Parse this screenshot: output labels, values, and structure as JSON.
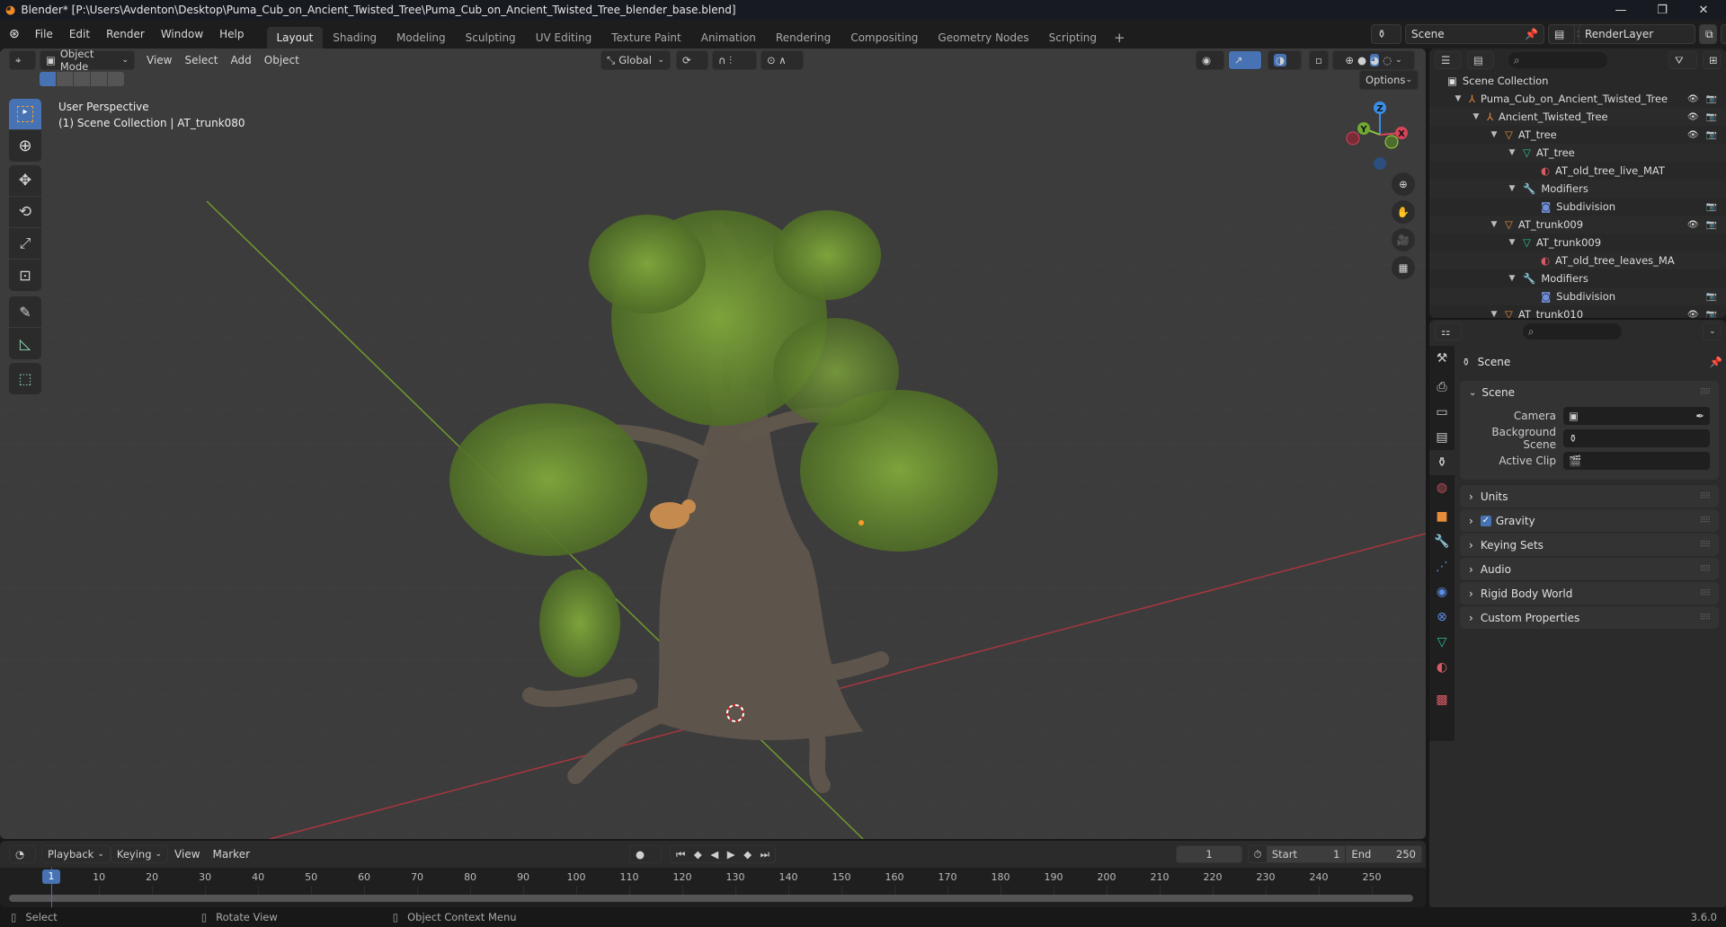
{
  "window": {
    "title": "Blender* [P:\\Users\\Avdenton\\Desktop\\Puma_Cub_on_Ancient_Twisted_Tree\\Puma_Cub_on_Ancient_Twisted_Tree_blender_base.blend]",
    "minimize": "—",
    "maximize": "❐",
    "close": "✕"
  },
  "menu": [
    "File",
    "Edit",
    "Render",
    "Window",
    "Help"
  ],
  "workspaces": [
    {
      "label": "Layout",
      "active": true
    },
    {
      "label": "Shading"
    },
    {
      "label": "Modeling"
    },
    {
      "label": "Sculpting"
    },
    {
      "label": "UV Editing"
    },
    {
      "label": "Texture Paint"
    },
    {
      "label": "Animation"
    },
    {
      "label": "Rendering"
    },
    {
      "label": "Compositing"
    },
    {
      "label": "Geometry Nodes"
    },
    {
      "label": "Scripting"
    },
    {
      "label": "+"
    }
  ],
  "scene_selector": {
    "value": "Scene"
  },
  "view_layer_selector": {
    "value": "RenderLayer"
  },
  "viewport_header": {
    "mode": "Object Mode",
    "menus": [
      "View",
      "Select",
      "Add",
      "Object"
    ],
    "transform_orientation": "Global",
    "options": "Options"
  },
  "viewport": {
    "perspective": "User Perspective",
    "context": "(1) Scene Collection | AT_trunk080",
    "gizmo": {
      "x": "X",
      "y": "Y",
      "z": "Z"
    }
  },
  "tools": [
    "select-box",
    "cursor",
    "move",
    "rotate",
    "scale",
    "transform",
    "annotate",
    "measure",
    "add-cube"
  ],
  "outliner": {
    "root": "Scene Collection",
    "items": [
      {
        "label": "Puma_Cub_on_Ancient_Twisted_Tree",
        "type": "empty",
        "depth": 0,
        "expanded": true,
        "eye": true,
        "render": true
      },
      {
        "label": "Ancient_Twisted_Tree",
        "type": "empty",
        "depth": 1,
        "expanded": true,
        "eye": true,
        "render": true
      },
      {
        "label": "AT_tree",
        "type": "object",
        "depth": 2,
        "expanded": true,
        "eye": true,
        "render": true
      },
      {
        "label": "AT_tree",
        "type": "mesh",
        "depth": 3,
        "expanded": true
      },
      {
        "label": "AT_old_tree_live_MAT",
        "type": "material",
        "depth": 4
      },
      {
        "label": "Modifiers",
        "type": "modifier",
        "depth": 3,
        "expanded": true
      },
      {
        "label": "Subdivision",
        "type": "subdiv",
        "depth": 4,
        "render": true
      },
      {
        "label": "AT_trunk009",
        "type": "object",
        "depth": 2,
        "expanded": true,
        "eye": true,
        "render": true
      },
      {
        "label": "AT_trunk009",
        "type": "mesh",
        "depth": 3,
        "expanded": true
      },
      {
        "label": "AT_old_tree_leaves_MA",
        "type": "material",
        "depth": 4
      },
      {
        "label": "Modifiers",
        "type": "modifier",
        "depth": 3,
        "expanded": true
      },
      {
        "label": "Subdivision",
        "type": "subdiv",
        "depth": 4,
        "render": true
      },
      {
        "label": "AT_trunk010",
        "type": "object",
        "depth": 2,
        "expanded": true,
        "eye": true,
        "render": true
      }
    ]
  },
  "properties": {
    "context_title": "Scene",
    "panels": {
      "scene": {
        "title": "Scene",
        "camera_label": "Camera",
        "background_scene_label": "Background Scene",
        "active_clip_label": "Active Clip"
      },
      "collapsed": [
        "Units",
        "Gravity",
        "Keying Sets",
        "Audio",
        "Rigid Body World",
        "Custom Properties"
      ],
      "gravity_checked": true
    }
  },
  "timeline": {
    "menus": [
      "Playback",
      "Keying",
      "View",
      "Marker"
    ],
    "current_frame": "1",
    "start_label": "Start",
    "start": "1",
    "end_label": "End",
    "end": "250",
    "ticks": [
      "10",
      "20",
      "30",
      "40",
      "50",
      "60",
      "70",
      "80",
      "90",
      "100",
      "110",
      "120",
      "130",
      "140",
      "150",
      "160",
      "170",
      "180",
      "190",
      "200",
      "210",
      "220",
      "230",
      "240",
      "250"
    ],
    "playhead": "1"
  },
  "status": {
    "select": "Select",
    "rotate": "Rotate View",
    "context_menu": "Object Context Menu",
    "version": "3.6.0"
  },
  "colors": {
    "accent": "#4772b3",
    "axis_x": "#d8445a",
    "axis_y": "#8cc63f",
    "axis_z": "#3a8ee6",
    "object_orange": "#e88d3a",
    "mesh_green": "#26c19c"
  }
}
